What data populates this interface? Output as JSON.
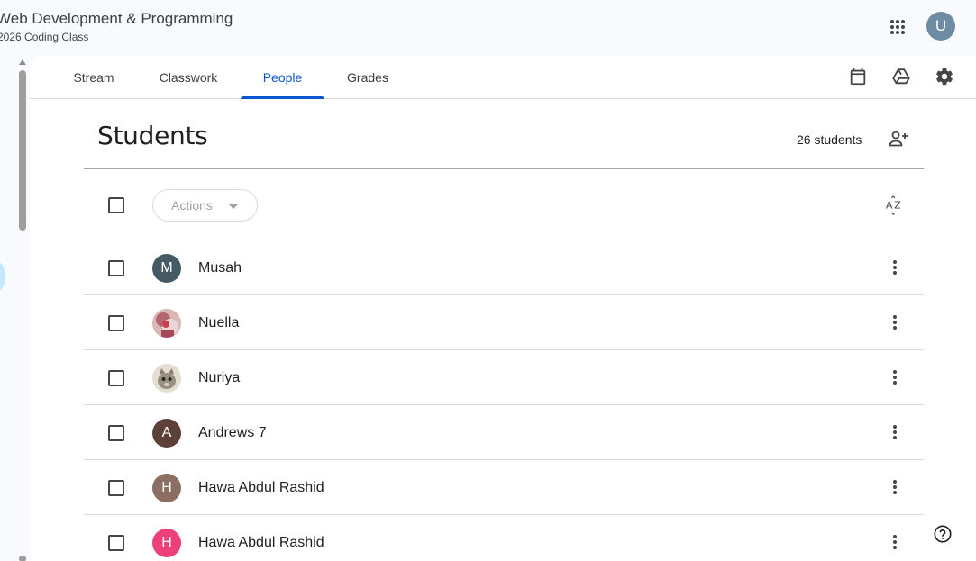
{
  "header": {
    "title": "Web Development & Programming",
    "subtitle": "2026 Coding Class",
    "user_initial": "U"
  },
  "tabs": [
    {
      "label": "Stream",
      "active": false
    },
    {
      "label": "Classwork",
      "active": false
    },
    {
      "label": "People",
      "active": true
    },
    {
      "label": "Grades",
      "active": false
    }
  ],
  "toolbar": {
    "icons": [
      "calendar-icon",
      "google-drive-icon",
      "settings-gear-icon"
    ]
  },
  "students": {
    "title": "Students",
    "count_label": "26 students",
    "actions_label": "Actions",
    "sort_icon": "sort-az-icon",
    "list": [
      {
        "name": "Musah",
        "initial": "M",
        "avatar_color": "#455a64",
        "photo": false
      },
      {
        "name": "Nuella",
        "initial": "",
        "avatar_color": "#c78a90",
        "photo": true
      },
      {
        "name": "Nuriya",
        "initial": "",
        "avatar_color": "#b9b2a6",
        "photo": true
      },
      {
        "name": "Andrews 7",
        "initial": "A",
        "avatar_color": "#5d4037",
        "photo": false
      },
      {
        "name": "Hawa Abdul Rashid",
        "initial": "H",
        "avatar_color": "#8d6e63",
        "photo": false
      },
      {
        "name": "Hawa Abdul Rashid",
        "initial": "H",
        "avatar_color": "#ec407a",
        "photo": false
      }
    ]
  },
  "colors": {
    "accent": "#0b57d0",
    "background": "#f8fafd"
  }
}
